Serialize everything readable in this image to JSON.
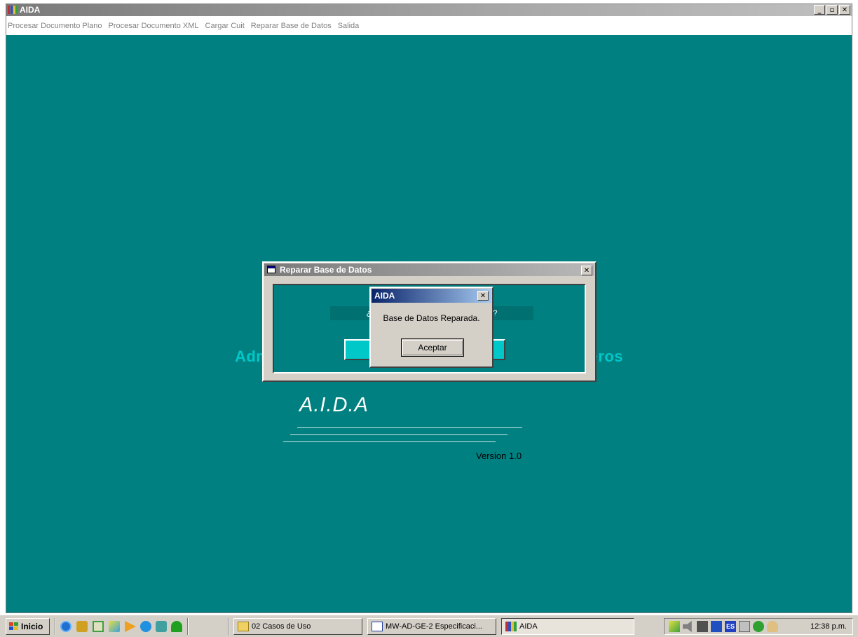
{
  "window": {
    "title": "AIDA",
    "controls": {
      "minimize": "_",
      "maximize": "▫",
      "close": "✕"
    }
  },
  "menu": {
    "items": [
      "Procesar Documento Plano",
      "Procesar Documento XML",
      "Cargar Cuit",
      "Reparar Base de Datos",
      "Salida"
    ]
  },
  "background": {
    "title": "Administr                                                    duaneros",
    "logo": "A.I.D.A",
    "version": "Version 1.0"
  },
  "reparar_dialog": {
    "title": "Reparar Base de Datos",
    "question": "¿ QUIERE                                    OS ?"
  },
  "message_box": {
    "title": "AIDA",
    "message": "Base de Datos Reparada.",
    "ok_label": "Aceptar"
  },
  "taskbar": {
    "start_label": "Inicio",
    "quick_launch": [
      "internet-explorer-icon",
      "outlook-icon",
      "desktop-icon",
      "tool-icon",
      "media-player-icon",
      "outlook-express-icon",
      "music-icon",
      "tree-icon"
    ],
    "tasks": [
      {
        "label": "02 Casos de Uso",
        "icon": "folder-icon"
      },
      {
        "label": "MW-AD-GE-2 Especificaci...",
        "icon": "word-icon"
      },
      {
        "label": "AIDA",
        "icon": "app-icon"
      }
    ],
    "tray_icons": [
      "network-icon",
      "volume-icon",
      "printer-icon",
      "monitor-icon",
      "language-icon",
      "display-icon",
      "security-icon",
      "user-icon"
    ],
    "language": "ES",
    "clock": "12:38 p.m."
  },
  "colors": {
    "desktop": "#008080",
    "accent_cyan": "#00c8c8",
    "dialog_face": "#d4d0c8",
    "active_title": "#0a246a"
  }
}
